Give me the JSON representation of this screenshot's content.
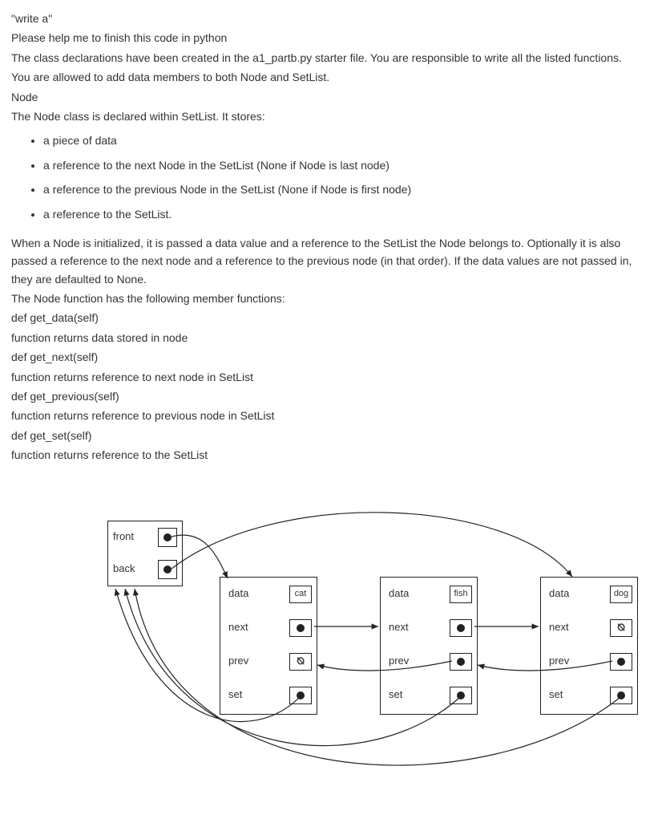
{
  "text": {
    "p1": "\"write a\"",
    "p2": "Please help me to finish this code in python",
    "p3": "The class declarations have been created in the a1_partb.py starter file. You are responsible to write all the listed functions.",
    "p4": "You are allowed to add data members to both Node and SetList.",
    "p5": "Node",
    "p6": "The Node class is declared within SetList. It stores:",
    "bullets": [
      "a piece of data",
      "a reference to the next Node in the SetList (None if Node is last node)",
      "a reference to the previous Node in the SetList (None if Node is first node)",
      "a reference to the SetList."
    ],
    "p7": "When a Node is initialized, it is passed a data value and a reference to the SetList the Node belongs to. Optionally it is also passed a reference to the next node and a reference to the previous node (in that order). If the data values are not passed in, they are defaulted to None.",
    "p8": "The Node function has the following member functions:",
    "p9": "def get_data(self)",
    "p10": "function returns data stored in node",
    "p11": "def get_next(self)",
    "p12": "function returns reference to next node in SetList",
    "p13": "def get_previous(self)",
    "p14": "function returns reference to previous node in SetList",
    "p15": "def get_set(self)",
    "p16": "function returns reference to the SetList"
  },
  "diagram": {
    "setlist": {
      "front": "front",
      "back": "back"
    },
    "node_labels": {
      "data": "data",
      "next": "next",
      "prev": "prev",
      "set": "set"
    },
    "null_symbol": "⦰",
    "nodes": [
      {
        "data": "cat",
        "next": "ptr",
        "prev": "null",
        "set": "ptr"
      },
      {
        "data": "fish",
        "next": "ptr",
        "prev": "ptr",
        "set": "ptr"
      },
      {
        "data": "dog",
        "next": "null",
        "prev": "ptr",
        "set": "ptr"
      }
    ]
  }
}
